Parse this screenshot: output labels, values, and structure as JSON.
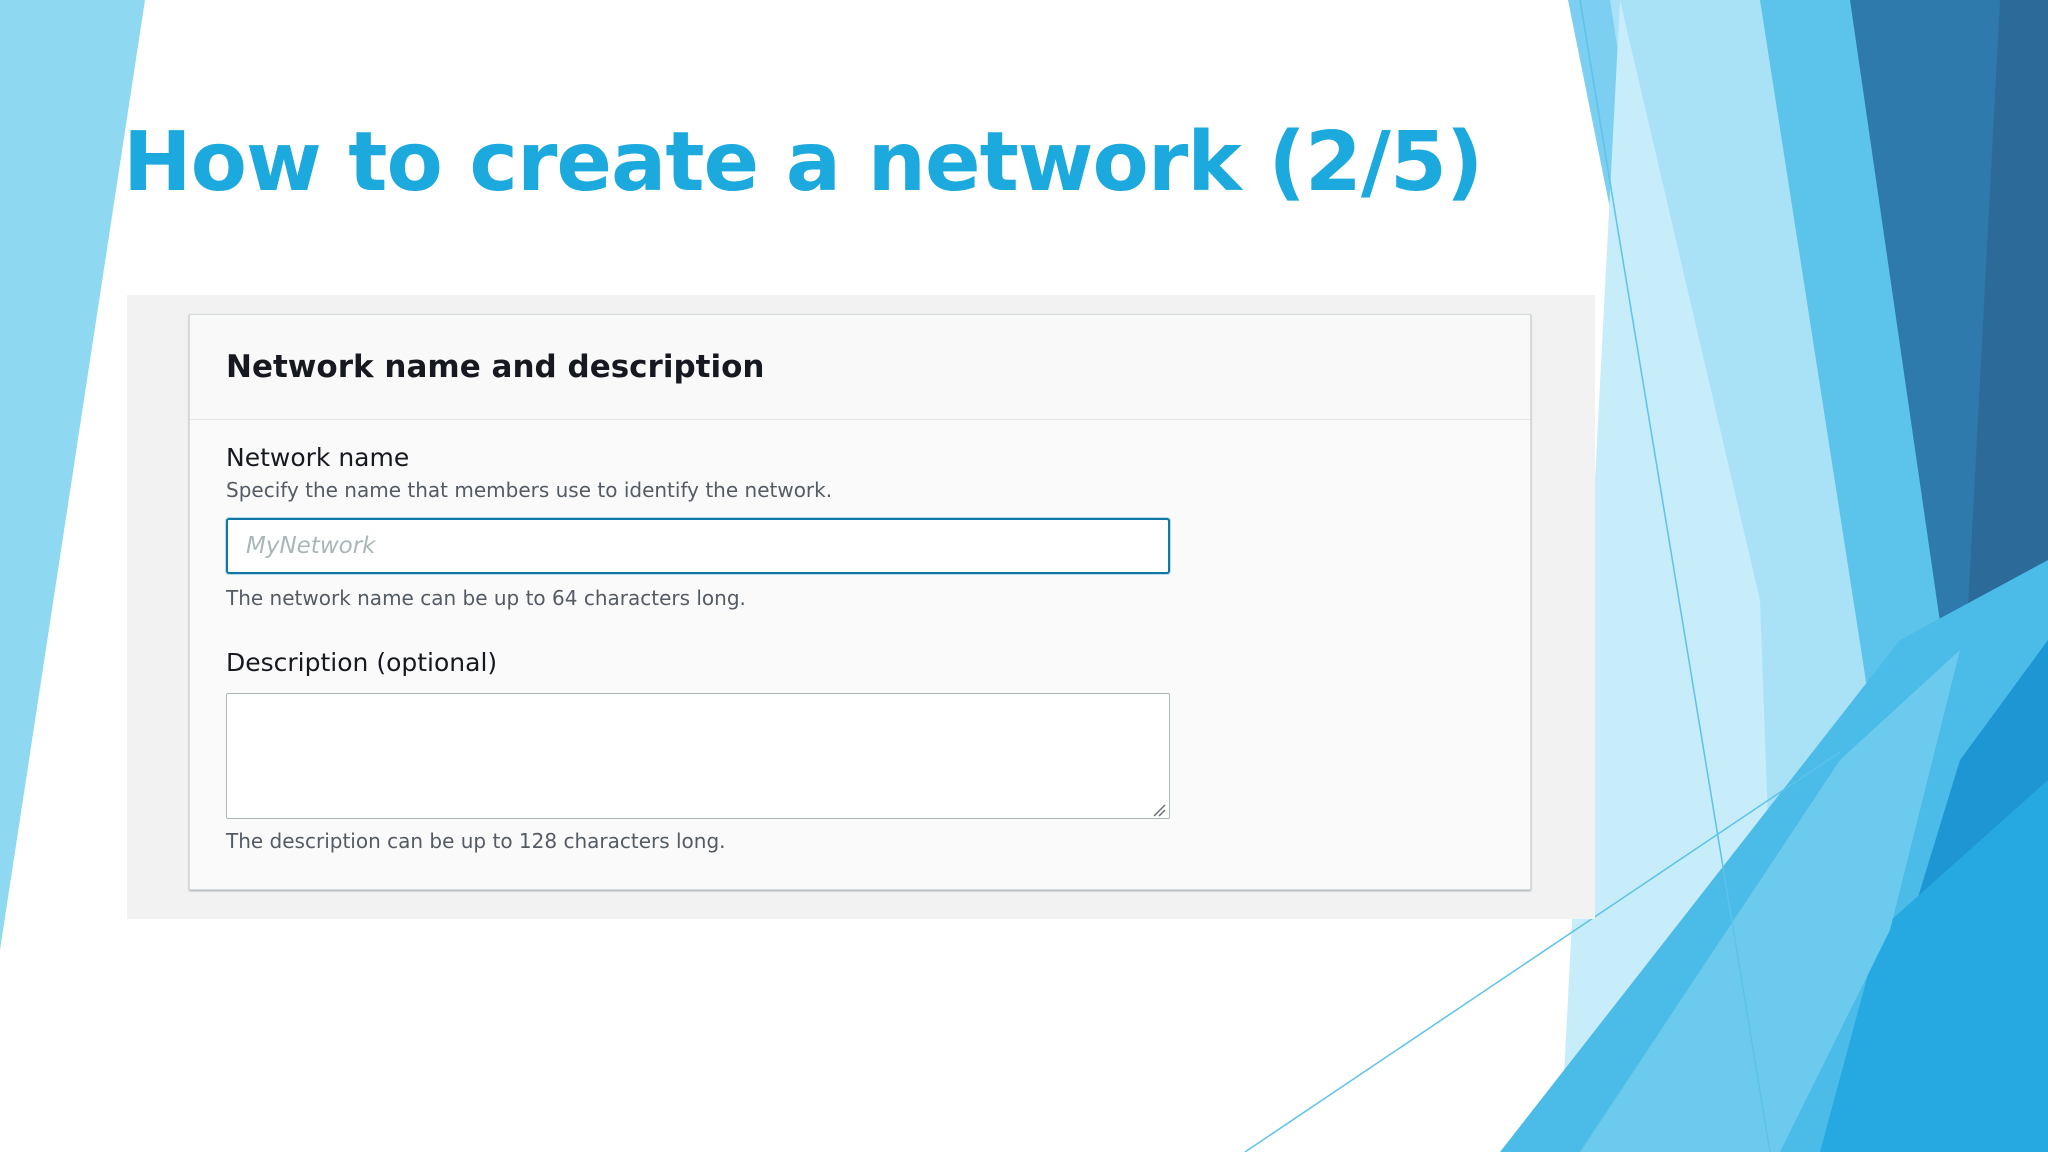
{
  "slide": {
    "title": "How to create a network (2/5)"
  },
  "form": {
    "section_title": "Network name and description",
    "network_name": {
      "label": "Network name",
      "description": "Specify the name that members use to identify the network.",
      "value": "",
      "placeholder": "MyNetwork",
      "constraint": "The network name can be up to 64 characters long."
    },
    "description": {
      "label": "Description (optional)",
      "value": "",
      "constraint": "The description can be up to 128 characters long."
    }
  },
  "colors": {
    "title": "#1ca9dd",
    "input_focus_border": "#0f78a6",
    "background_blues": [
      "#8fd8f2",
      "#5ac2ea",
      "#2e6fa0",
      "#1d9ad6"
    ]
  }
}
